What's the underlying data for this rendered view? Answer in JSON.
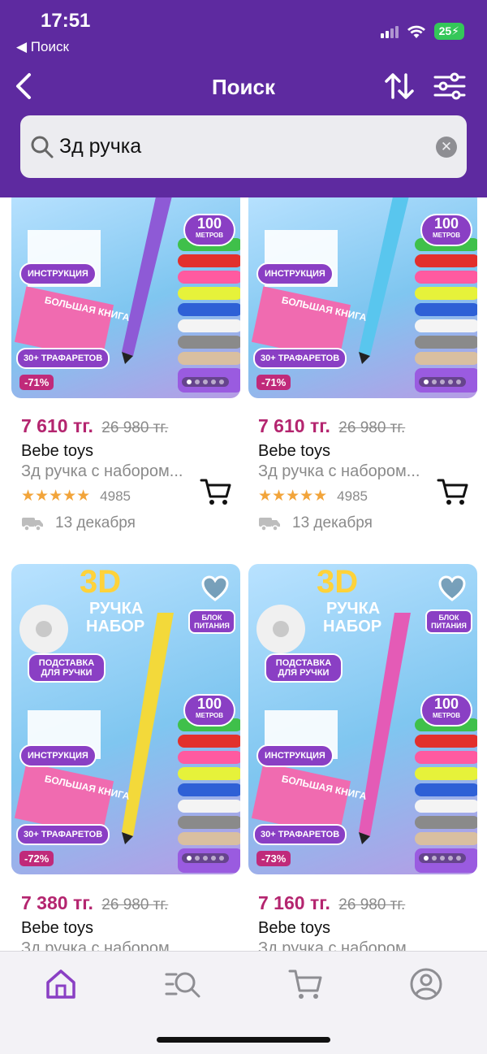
{
  "status_bar": {
    "time": "17:51",
    "back_app": "◀ Поиск",
    "battery": "25"
  },
  "nav": {
    "title": "Поиск"
  },
  "search": {
    "query": "Зд ручка"
  },
  "products": [
    {
      "price": "7 610 тг.",
      "old_price": "26 980 тг.",
      "brand": "Bebe toys",
      "description": "Зд ручка с набором...",
      "stars": "★★★★★",
      "reviews": "4985",
      "delivery": "13 декабря",
      "discount": "-71%",
      "pen_color": "#8e5ad6"
    },
    {
      "price": "7 610 тг.",
      "old_price": "26 980 тг.",
      "brand": "Bebe toys",
      "description": "Зд ручка с набором...",
      "stars": "★★★★★",
      "reviews": "4985",
      "delivery": "13 декабря",
      "discount": "-71%",
      "pen_color": "#59c6ee"
    },
    {
      "price": "7 380 тг.",
      "old_price": "26 980 тг.",
      "brand": "Bebe toys",
      "description": "Зд ручка с набором...",
      "discount": "-72%",
      "pen_color": "#f3d93a"
    },
    {
      "price": "7 160 тг.",
      "old_price": "26 980 тг.",
      "brand": "Bebe toys",
      "description": "Зд ручка с набором...",
      "discount": "-73%",
      "pen_color": "#e45bb6"
    }
  ],
  "image_text": {
    "meters": "100",
    "meters_unit": "МЕТРОВ",
    "instructions": "ИНСТРУКЦИЯ",
    "book": "БОЛЬШАЯ КНИГА",
    "stencils": "30+ ТРАФАРЕТОВ",
    "title_3d": "3D",
    "title_pen": "РУЧКА",
    "title_set": "НАБОР",
    "stand": "ПОДСТАВКА ДЛЯ РУЧКИ",
    "power": "БЛОК ПИТАНИЯ"
  },
  "colors": {
    "header": "#5e2aa0",
    "price": "#b4256f",
    "accent": "#8a3fc4"
  },
  "tabs": [
    "home-icon",
    "catalog-search-icon",
    "cart-icon",
    "profile-icon"
  ]
}
